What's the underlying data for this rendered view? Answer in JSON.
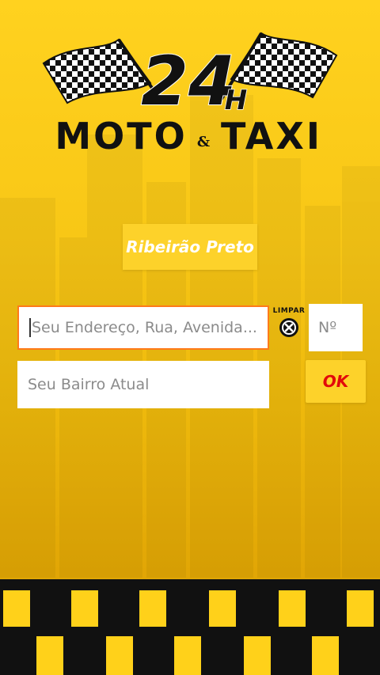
{
  "logo": {
    "big": "24",
    "small": "H",
    "word1": "MOTO",
    "amp": "&",
    "word2": "TAXI"
  },
  "city_button": {
    "label": "Ribeirão Preto"
  },
  "address_field": {
    "placeholder": "Seu Endereço, Rua, Avenida..."
  },
  "clear_button": {
    "label": "LIMPAR",
    "icon": "close-circle-icon"
  },
  "number_field": {
    "placeholder": "Nº"
  },
  "bairro_field": {
    "placeholder": "Seu Bairro Atual"
  },
  "ok_button": {
    "label": "OK"
  },
  "colors": {
    "background": "#f8c716",
    "button": "#fdd22a",
    "ok_text": "#e20a0a",
    "focus_border": "#ff7a1a",
    "checker_dark": "#111111",
    "checker_light": "#ffd11a"
  }
}
